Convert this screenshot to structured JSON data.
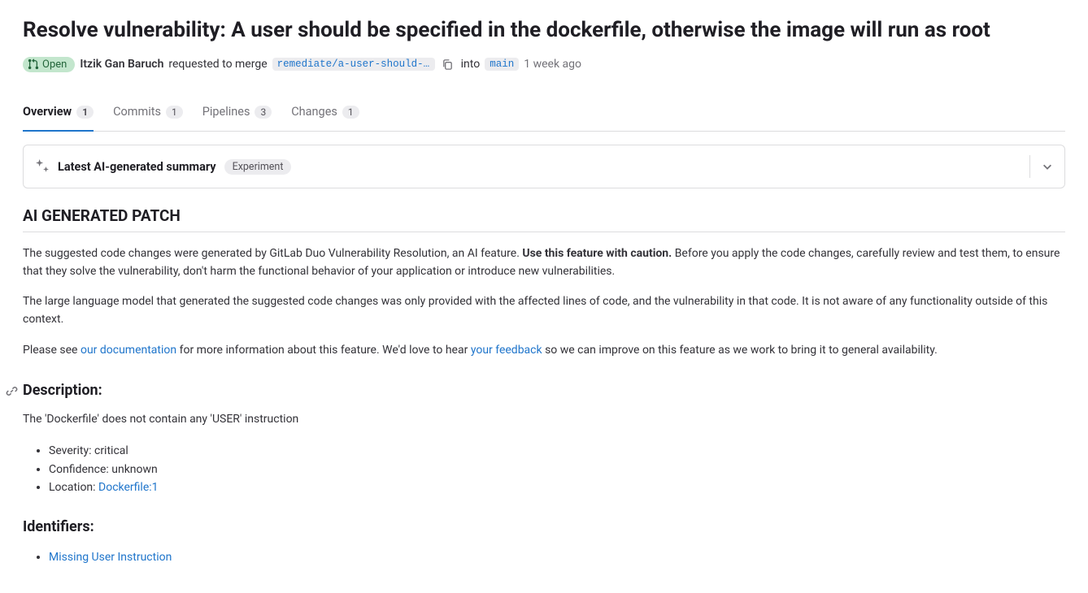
{
  "page": {
    "title": "Resolve vulnerability: A user should be specified in the dockerfile, otherwise the image will run as root"
  },
  "status": {
    "label": "Open"
  },
  "merge": {
    "author": "Itzik Gan Baruch",
    "requested_text": "requested to merge",
    "source_branch": "remediate/a-user-should-be…",
    "into_text": "into",
    "target_branch": "main",
    "timestamp": "1 week ago"
  },
  "tabs": [
    {
      "label": "Overview",
      "count": "1",
      "active": true
    },
    {
      "label": "Commits",
      "count": "1",
      "active": false
    },
    {
      "label": "Pipelines",
      "count": "3",
      "active": false
    },
    {
      "label": "Changes",
      "count": "1",
      "active": false
    }
  ],
  "summary": {
    "title": "Latest AI-generated summary",
    "badge": "Experiment"
  },
  "section_heading": "AI GENERATED PATCH",
  "paragraphs": {
    "p1_a": "The suggested code changes were generated by GitLab Duo Vulnerability Resolution, an AI feature. ",
    "p1_bold": "Use this feature with caution.",
    "p1_b": " Before you apply the code changes, carefully review and test them, to ensure that they solve the vulnerability, don't harm the functional behavior of your application or introduce new vulnerabilities.",
    "p2": "The large language model that generated the suggested code changes was only provided with the affected lines of code, and the vulnerability in that code. It is not aware of any functionality outside of this context.",
    "p3_a": "Please see ",
    "p3_link1": "our documentation",
    "p3_b": " for more information about this feature. We'd love to hear ",
    "p3_link2": "your feedback",
    "p3_c": " so we can improve on this feature as we work to bring it to general availability."
  },
  "description": {
    "heading": "Description:",
    "text": "The 'Dockerfile' does not contain any 'USER' instruction",
    "items": {
      "severity_label": "Severity: ",
      "severity_value": "critical",
      "confidence_label": "Confidence: ",
      "confidence_value": "unknown",
      "location_label": "Location: ",
      "location_link": "Dockerfile:1"
    }
  },
  "identifiers": {
    "heading": "Identifiers:",
    "items": [
      {
        "label": "Missing User Instruction"
      }
    ]
  }
}
